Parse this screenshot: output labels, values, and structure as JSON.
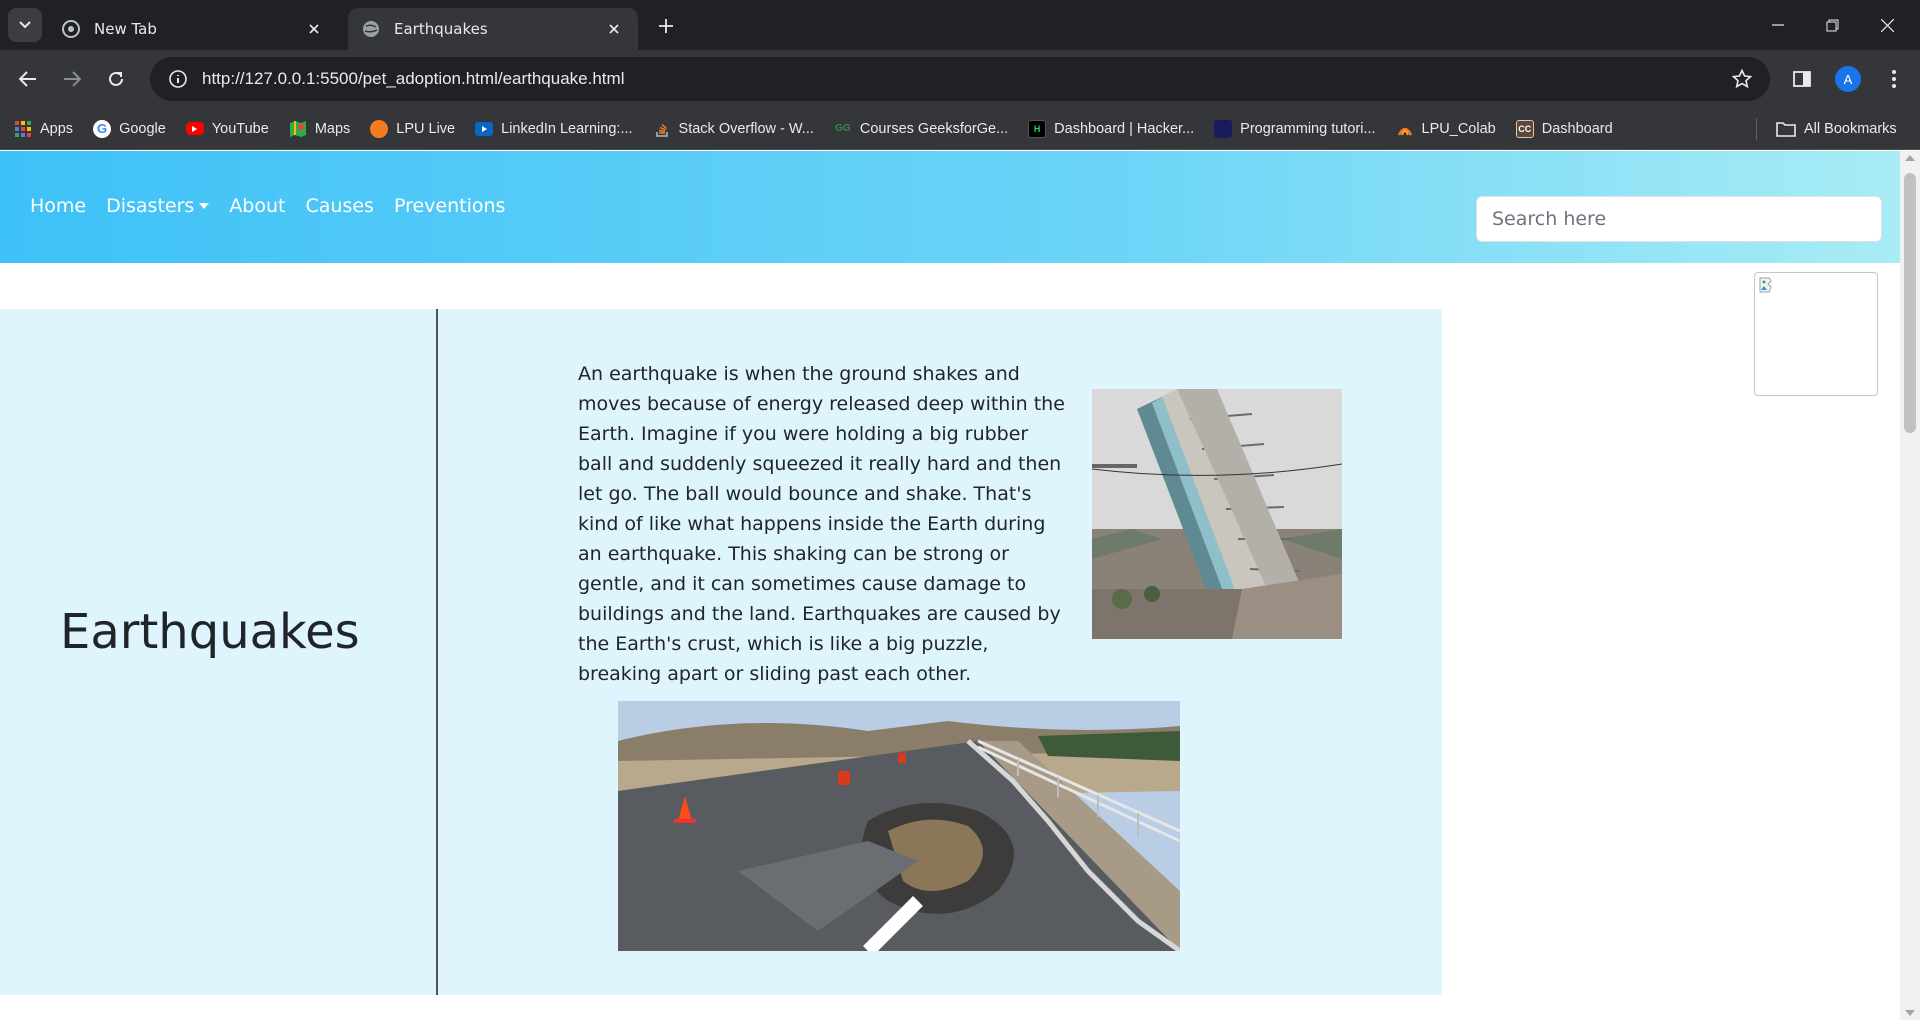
{
  "browser": {
    "tabs": [
      {
        "title": "New Tab",
        "icon": "chrome-icon",
        "active": false
      },
      {
        "title": "Earthquakes",
        "icon": "globe-icon",
        "active": true
      }
    ],
    "url": "http://127.0.0.1:5500/pet_adoption.html/earthquake.html",
    "profile_initial": "A",
    "bookmarks": [
      {
        "label": "Apps",
        "icon": "apps-grid-icon",
        "color": "#ea4335"
      },
      {
        "label": "Google",
        "icon": "google-icon",
        "color": "#ffffff"
      },
      {
        "label": "YouTube",
        "icon": "youtube-icon",
        "color": "#ff0000"
      },
      {
        "label": "Maps",
        "icon": "maps-icon",
        "color": "#34a853"
      },
      {
        "label": "LPU Live",
        "icon": "lpu-live-icon",
        "color": "#f47b20"
      },
      {
        "label": "LinkedIn Learning:...",
        "icon": "linkedin-learning-icon",
        "color": "#0a66c2"
      },
      {
        "label": "Stack Overflow - W...",
        "icon": "stackoverflow-icon",
        "color": "#f48024"
      },
      {
        "label": "Courses GeeksforGe...",
        "icon": "geeksforgeeks-icon",
        "color": "#2f8d46"
      },
      {
        "label": "Dashboard | Hacker...",
        "icon": "hackerrank-icon",
        "color": "#000000"
      },
      {
        "label": "Programming tutori...",
        "icon": "programming-icon",
        "color": "#1a1a5e"
      },
      {
        "label": "LPU_Colab",
        "icon": "lpu-colab-icon",
        "color": "#f47b20"
      },
      {
        "label": "Dashboard",
        "icon": "codechef-icon",
        "color": "#5b4638"
      }
    ],
    "all_bookmarks": "All Bookmarks"
  },
  "nav": {
    "links": [
      "Home",
      "Disasters",
      "About",
      "Causes",
      "Preventions"
    ],
    "search_placeholder": "Search here"
  },
  "main": {
    "heading": "Earthquakes",
    "paragraph": "An earthquake is when the ground shakes and moves because of energy released deep within the Earth. Imagine if you were holding a big rubber ball and suddenly squeezed it really hard and then let go. The ball would bounce and shake. That's kind of like what happens inside the Earth during an earthquake. This shaking can be strong or gentle, and it can sometimes cause damage to buildings and the land. Earthquakes are caused by the Earth's crust, which is like a big puzzle, breaking apart or sliding past each other."
  },
  "colors": {
    "nav_gradient_start": "#3ec1f7",
    "nav_gradient_end": "#a8ecf5",
    "panel_bg": "#dff5fe"
  }
}
